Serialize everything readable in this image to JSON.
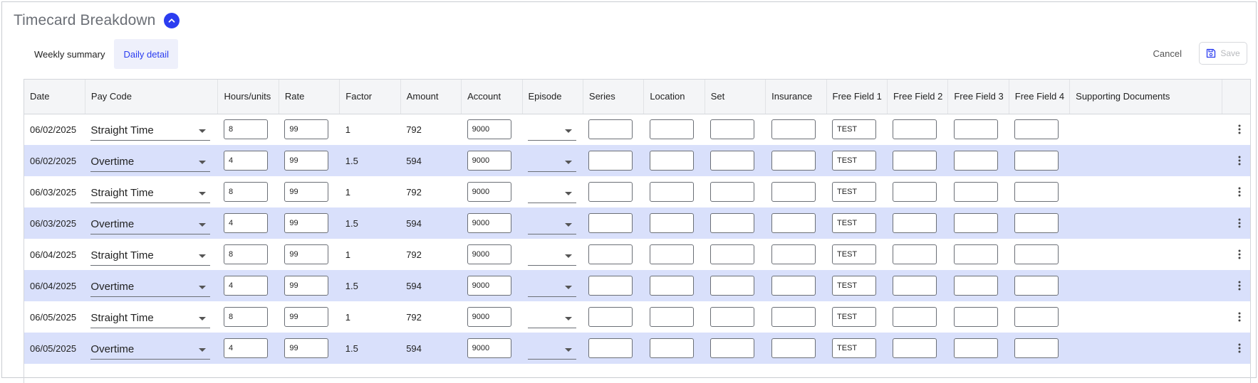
{
  "page": {
    "title": "Timecard Breakdown"
  },
  "tabs": [
    {
      "label": "Weekly summary",
      "active": false
    },
    {
      "label": "Daily detail",
      "active": true
    }
  ],
  "actions": {
    "cancel_label": "Cancel",
    "save_label": "Save"
  },
  "colors": {
    "accent": "#2b3df0",
    "row_alt": "#d9e0fb",
    "header_bg": "#f4f5f7"
  },
  "icons": {
    "collapse": "chevron-up-icon",
    "save": "floppy-disk-icon",
    "row_menu": "kebab-menu-icon",
    "dropdown": "caret-down-icon"
  },
  "table": {
    "columns": [
      "Date",
      "Pay Code",
      "Hours/units",
      "Rate",
      "Factor",
      "Amount",
      "Account",
      "Episode",
      "Series",
      "Location",
      "Set",
      "Insurance",
      "Free Field 1",
      "Free Field 2",
      "Free Field 3",
      "Free Field 4",
      "Supporting Documents",
      ""
    ],
    "rows": [
      {
        "date": "06/02/2025",
        "pay_code": "Straight Time",
        "hours": "8",
        "rate": "99",
        "factor": "1",
        "amount": "792",
        "account": "9000",
        "episode": "",
        "series": "",
        "location": "",
        "set": "",
        "insurance": "",
        "free1": "TEST",
        "free2": "",
        "free3": "",
        "free4": ""
      },
      {
        "date": "06/02/2025",
        "pay_code": "Overtime",
        "hours": "4",
        "rate": "99",
        "factor": "1.5",
        "amount": "594",
        "account": "9000",
        "episode": "",
        "series": "",
        "location": "",
        "set": "",
        "insurance": "",
        "free1": "TEST",
        "free2": "",
        "free3": "",
        "free4": ""
      },
      {
        "date": "06/03/2025",
        "pay_code": "Straight Time",
        "hours": "8",
        "rate": "99",
        "factor": "1",
        "amount": "792",
        "account": "9000",
        "episode": "",
        "series": "",
        "location": "",
        "set": "",
        "insurance": "",
        "free1": "TEST",
        "free2": "",
        "free3": "",
        "free4": ""
      },
      {
        "date": "06/03/2025",
        "pay_code": "Overtime",
        "hours": "4",
        "rate": "99",
        "factor": "1.5",
        "amount": "594",
        "account": "9000",
        "episode": "",
        "series": "",
        "location": "",
        "set": "",
        "insurance": "",
        "free1": "TEST",
        "free2": "",
        "free3": "",
        "free4": ""
      },
      {
        "date": "06/04/2025",
        "pay_code": "Straight Time",
        "hours": "8",
        "rate": "99",
        "factor": "1",
        "amount": "792",
        "account": "9000",
        "episode": "",
        "series": "",
        "location": "",
        "set": "",
        "insurance": "",
        "free1": "TEST",
        "free2": "",
        "free3": "",
        "free4": ""
      },
      {
        "date": "06/04/2025",
        "pay_code": "Overtime",
        "hours": "4",
        "rate": "99",
        "factor": "1.5",
        "amount": "594",
        "account": "9000",
        "episode": "",
        "series": "",
        "location": "",
        "set": "",
        "insurance": "",
        "free1": "TEST",
        "free2": "",
        "free3": "",
        "free4": ""
      },
      {
        "date": "06/05/2025",
        "pay_code": "Straight Time",
        "hours": "8",
        "rate": "99",
        "factor": "1",
        "amount": "792",
        "account": "9000",
        "episode": "",
        "series": "",
        "location": "",
        "set": "",
        "insurance": "",
        "free1": "TEST",
        "free2": "",
        "free3": "",
        "free4": ""
      },
      {
        "date": "06/05/2025",
        "pay_code": "Overtime",
        "hours": "4",
        "rate": "99",
        "factor": "1.5",
        "amount": "594",
        "account": "9000",
        "episode": "",
        "series": "",
        "location": "",
        "set": "",
        "insurance": "",
        "free1": "TEST",
        "free2": "",
        "free3": "",
        "free4": ""
      }
    ]
  }
}
